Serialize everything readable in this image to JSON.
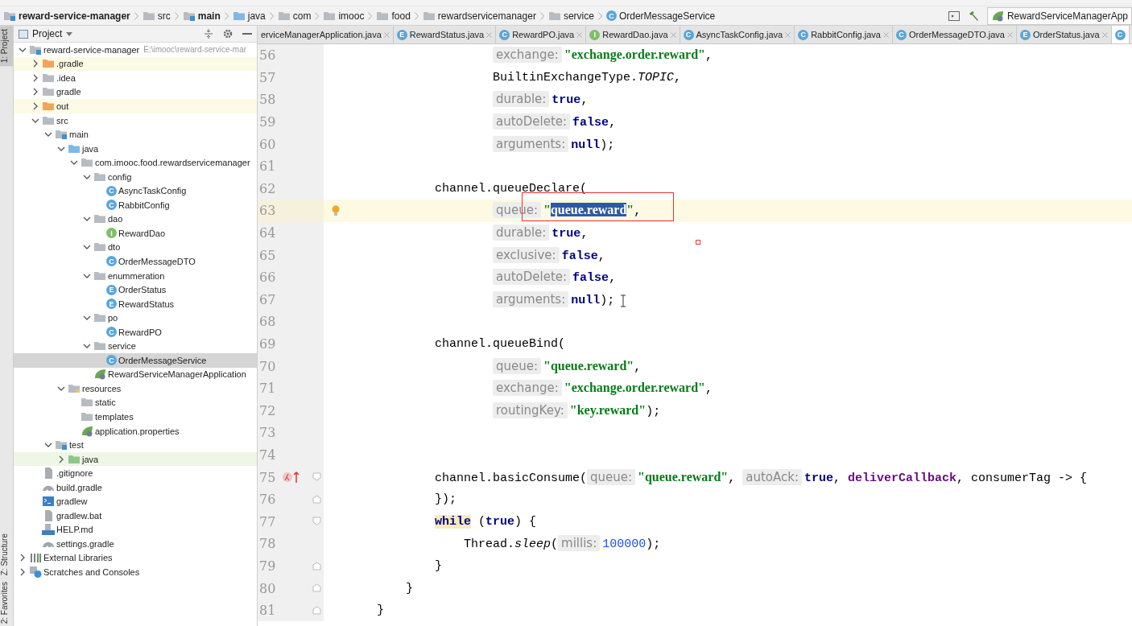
{
  "breadcrumbs": [
    {
      "label": "reward-service-manager",
      "kind": "module",
      "bold": true
    },
    {
      "label": "src",
      "kind": "folder",
      "bold": false
    },
    {
      "label": "main",
      "kind": "module",
      "bold": true
    },
    {
      "label": "java",
      "kind": "source",
      "bold": false
    },
    {
      "label": "com",
      "kind": "package",
      "bold": false
    },
    {
      "label": "imooc",
      "kind": "package",
      "bold": false
    },
    {
      "label": "food",
      "kind": "package",
      "bold": false
    },
    {
      "label": "rewardservicemanager",
      "kind": "package",
      "bold": false
    },
    {
      "label": "service",
      "kind": "package",
      "bold": false
    },
    {
      "label": "OrderMessageService",
      "kind": "class",
      "badge": "C",
      "bold": false
    }
  ],
  "run_config": {
    "label": "RewardServiceManagerApp"
  },
  "tool_strip": [
    {
      "label": "1: Project",
      "selected": true
    },
    {
      "label": "Z: Structure",
      "selected": false
    },
    {
      "label": "2: Favorites",
      "selected": false
    }
  ],
  "project_panel": {
    "title": "Project",
    "tree": [
      {
        "label": "reward-service-manager",
        "path": "E:\\imooc\\reward-service-mar",
        "kind": "module",
        "expanded": true,
        "selected": false,
        "children": [
          {
            "label": ".gradle",
            "kind": "excluded",
            "expanded": false,
            "selected": false
          },
          {
            "label": ".idea",
            "kind": "folder",
            "expanded": false,
            "selected": false
          },
          {
            "label": "gradle",
            "kind": "folder",
            "expanded": false,
            "selected": false
          },
          {
            "label": "out",
            "kind": "excluded",
            "expanded": false,
            "selected": false
          },
          {
            "label": "src",
            "kind": "folder",
            "expanded": true,
            "selected": false,
            "children": [
              {
                "label": "main",
                "kind": "module",
                "expanded": true,
                "selected": false,
                "children": [
                  {
                    "label": "java",
                    "kind": "source",
                    "expanded": true,
                    "selected": false,
                    "children": [
                      {
                        "label": "com.imooc.food.rewardservicemanager",
                        "kind": "package",
                        "expanded": true,
                        "selected": false,
                        "children": [
                          {
                            "label": "config",
                            "kind": "package",
                            "expanded": true,
                            "selected": false,
                            "children": [
                              {
                                "label": "AsyncTaskConfig",
                                "kind": "class",
                                "badge": "C",
                                "selected": false
                              },
                              {
                                "label": "RabbitConfig",
                                "kind": "class",
                                "badge": "C",
                                "selected": false
                              }
                            ]
                          },
                          {
                            "label": "dao",
                            "kind": "package",
                            "expanded": true,
                            "selected": false,
                            "children": [
                              {
                                "label": "RewardDao",
                                "kind": "interface",
                                "badge": "I",
                                "selected": false
                              }
                            ]
                          },
                          {
                            "label": "dto",
                            "kind": "package",
                            "expanded": true,
                            "selected": false,
                            "children": [
                              {
                                "label": "OrderMessageDTO",
                                "kind": "class",
                                "badge": "C",
                                "selected": false
                              }
                            ]
                          },
                          {
                            "label": "enummeration",
                            "kind": "package",
                            "expanded": true,
                            "selected": false,
                            "children": [
                              {
                                "label": "OrderStatus",
                                "kind": "class",
                                "badge": "E",
                                "selected": false
                              },
                              {
                                "label": "RewardStatus",
                                "kind": "class",
                                "badge": "E",
                                "selected": false
                              }
                            ]
                          },
                          {
                            "label": "po",
                            "kind": "package",
                            "expanded": true,
                            "selected": false,
                            "children": [
                              {
                                "label": "RewardPO",
                                "kind": "class",
                                "badge": "C",
                                "selected": false
                              }
                            ]
                          },
                          {
                            "label": "service",
                            "kind": "package",
                            "expanded": true,
                            "selected": false,
                            "children": [
                              {
                                "label": "OrderMessageService",
                                "kind": "class",
                                "badge": "C",
                                "selected": true
                              }
                            ]
                          },
                          {
                            "label": "RewardServiceManagerApplication",
                            "kind": "spring",
                            "selected": false
                          }
                        ]
                      }
                    ]
                  },
                  {
                    "label": "resources",
                    "kind": "resources",
                    "expanded": true,
                    "selected": false,
                    "children": [
                      {
                        "label": "static",
                        "kind": "package",
                        "selected": false
                      },
                      {
                        "label": "templates",
                        "kind": "package",
                        "selected": false
                      },
                      {
                        "label": "application.properties",
                        "kind": "spring",
                        "selected": false
                      }
                    ]
                  }
                ]
              },
              {
                "label": "test",
                "kind": "module",
                "expanded": true,
                "selected": false,
                "children": [
                  {
                    "label": "java",
                    "kind": "test",
                    "expanded": false,
                    "selected": false
                  }
                ]
              }
            ]
          },
          {
            "label": ".gitignore",
            "kind": "file",
            "selected": false
          },
          {
            "label": "build.gradle",
            "kind": "gradle",
            "selected": false
          },
          {
            "label": "gradlew",
            "kind": "terminal",
            "selected": false
          },
          {
            "label": "gradlew.bat",
            "kind": "file",
            "selected": false
          },
          {
            "label": "HELP.md",
            "kind": "markdown",
            "selected": false
          },
          {
            "label": "settings.gradle",
            "kind": "gradle",
            "selected": false
          }
        ]
      },
      {
        "label": "External Libraries",
        "kind": "libraries",
        "expanded": false,
        "selected": false
      },
      {
        "label": "Scratches and Consoles",
        "kind": "scratches",
        "expanded": false,
        "selected": false
      }
    ]
  },
  "tabs": [
    {
      "label": "erviceManagerApplication.java",
      "kind": "plain",
      "selected": false
    },
    {
      "label": "RewardStatus.java",
      "badge": "E",
      "kind": "class",
      "selected": false
    },
    {
      "label": "RewardPO.java",
      "badge": "C",
      "kind": "class",
      "selected": false
    },
    {
      "label": "RewardDao.java",
      "badge": "I",
      "kind": "interface",
      "selected": false
    },
    {
      "label": "AsyncTaskConfig.java",
      "badge": "C",
      "kind": "class",
      "selected": false
    },
    {
      "label": "RabbitConfig.java",
      "badge": "C",
      "kind": "class",
      "selected": false
    },
    {
      "label": "OrderMessageDTO.java",
      "badge": "C",
      "kind": "class",
      "selected": false
    },
    {
      "label": "OrderStatus.java",
      "badge": "E",
      "kind": "class",
      "selected": false
    },
    {
      "badge": "C",
      "kind": "class",
      "selected": true
    }
  ],
  "editor": {
    "lines": [
      {
        "number": "56",
        "kind": "arg",
        "current": false,
        "tokens": [
          {
            "kind": "hint",
            "text": "exchange:"
          },
          {
            "kind": "string",
            "text": "\"exchange.order.reward\""
          },
          {
            "kind": "plain",
            "text": ","
          }
        ]
      },
      {
        "number": "57",
        "kind": "arg",
        "current": false,
        "tokens": [
          {
            "kind": "plain",
            "text": "BuiltinExchangeType."
          },
          {
            "kind": "static",
            "text": "TOPIC"
          },
          {
            "kind": "plain",
            "text": ","
          }
        ]
      },
      {
        "number": "58",
        "kind": "arg",
        "current": false,
        "tokens": [
          {
            "kind": "hint",
            "text": "durable:"
          },
          {
            "kind": "keyword",
            "text": "true"
          },
          {
            "kind": "plain",
            "text": ","
          }
        ]
      },
      {
        "number": "59",
        "kind": "arg",
        "current": false,
        "tokens": [
          {
            "kind": "hint",
            "text": "autoDelete:"
          },
          {
            "kind": "keyword",
            "text": "false"
          },
          {
            "kind": "plain",
            "text": ","
          }
        ]
      },
      {
        "number": "60",
        "kind": "arg",
        "current": false,
        "tokens": [
          {
            "kind": "hint",
            "text": "arguments:"
          },
          {
            "kind": "keyword",
            "text": "null"
          },
          {
            "kind": "plain",
            "text": ");"
          }
        ]
      },
      {
        "number": "61",
        "current": false
      },
      {
        "number": "62",
        "kind": "statement",
        "current": false,
        "tokens": [
          {
            "kind": "plain",
            "text": "channel.queueDeclare("
          }
        ]
      },
      {
        "number": "63",
        "kind": "arg",
        "current": true,
        "gutter_icon": {
          "kind": "bulb"
        },
        "tokens": [
          {
            "kind": "hint",
            "text": "queue:"
          },
          {
            "kind": "string",
            "text": "\""
          },
          {
            "kind": "selection",
            "text": "queue.reward"
          },
          {
            "kind": "string",
            "text": "\""
          },
          {
            "kind": "plain",
            "text": ","
          }
        ]
      },
      {
        "number": "64",
        "kind": "arg",
        "current": false,
        "tokens": [
          {
            "kind": "hint",
            "text": "durable:"
          },
          {
            "kind": "keyword",
            "text": "true"
          },
          {
            "kind": "plain",
            "text": ","
          }
        ]
      },
      {
        "number": "65",
        "kind": "arg",
        "current": false,
        "tokens": [
          {
            "kind": "hint",
            "text": "exclusive:"
          },
          {
            "kind": "keyword",
            "text": "false"
          },
          {
            "kind": "plain",
            "text": ","
          }
        ]
      },
      {
        "number": "66",
        "kind": "arg",
        "current": false,
        "tokens": [
          {
            "kind": "hint",
            "text": "autoDelete:"
          },
          {
            "kind": "keyword",
            "text": "false"
          },
          {
            "kind": "plain",
            "text": ","
          }
        ]
      },
      {
        "number": "67",
        "kind": "arg",
        "current": false,
        "tokens": [
          {
            "kind": "hint",
            "text": "arguments:"
          },
          {
            "kind": "keyword",
            "text": "null"
          },
          {
            "kind": "plain",
            "text": ");"
          }
        ]
      },
      {
        "number": "68",
        "current": false
      },
      {
        "number": "69",
        "kind": "statement",
        "current": false,
        "tokens": [
          {
            "kind": "plain",
            "text": "channel.queueBind("
          }
        ]
      },
      {
        "number": "70",
        "kind": "arg",
        "current": false,
        "tokens": [
          {
            "kind": "hint",
            "text": "queue:"
          },
          {
            "kind": "string",
            "text": "\"queue.reward\""
          },
          {
            "kind": "plain",
            "text": ","
          }
        ]
      },
      {
        "number": "71",
        "kind": "arg",
        "current": false,
        "tokens": [
          {
            "kind": "hint",
            "text": "exchange:"
          },
          {
            "kind": "string",
            "text": "\"exchange.order.reward\""
          },
          {
            "kind": "plain",
            "text": ","
          }
        ]
      },
      {
        "number": "72",
        "kind": "arg",
        "current": false,
        "tokens": [
          {
            "kind": "hint",
            "text": "routingKey:"
          },
          {
            "kind": "string",
            "text": "\"key.reward\""
          },
          {
            "kind": "plain",
            "text": ");"
          }
        ]
      },
      {
        "number": "73",
        "current": false
      },
      {
        "number": "74",
        "current": false
      },
      {
        "number": "75",
        "kind": "statement",
        "current": false,
        "gutter_icon": {
          "kind": "lambda"
        },
        "fold_marker": {
          "kind": "start"
        },
        "tokens": [
          {
            "kind": "plain",
            "text": "channel.basicConsume("
          },
          {
            "kind": "hint",
            "text": "queue:"
          },
          {
            "kind": "string",
            "text": "\"queue.reward\""
          },
          {
            "kind": "plain",
            "text": ", "
          },
          {
            "kind": "hint",
            "text": "autoAck:"
          },
          {
            "kind": "keyword",
            "text": "true"
          },
          {
            "kind": "plain",
            "text": ", "
          },
          {
            "kind": "field",
            "text": "deliverCallback"
          },
          {
            "kind": "plain",
            "text": ", consumerTag -> {"
          }
        ]
      },
      {
        "number": "76",
        "kind": "statement",
        "current": false,
        "fold_marker": {
          "kind": "end"
        },
        "tokens": [
          {
            "kind": "plain",
            "text": "});"
          }
        ]
      },
      {
        "number": "77",
        "kind": "statement",
        "current": false,
        "fold_marker": {
          "kind": "start"
        },
        "tokens": [
          {
            "kind": "marked",
            "text": "while"
          },
          {
            "kind": "plain",
            "text": " ("
          },
          {
            "kind": "keyword",
            "text": "true"
          },
          {
            "kind": "plain",
            "text": ") {"
          }
        ]
      },
      {
        "number": "78",
        "kind": "body",
        "current": false,
        "tokens": [
          {
            "kind": "plain",
            "text": "Thread."
          },
          {
            "kind": "static",
            "text": "sleep"
          },
          {
            "kind": "plain",
            "text": "("
          },
          {
            "kind": "hint",
            "text": "millis:"
          },
          {
            "kind": "number",
            "text": "100000"
          },
          {
            "kind": "plain",
            "text": ");"
          }
        ]
      },
      {
        "number": "79",
        "kind": "statement",
        "current": false,
        "fold_marker": {
          "kind": "end"
        },
        "tokens": [
          {
            "kind": "plain",
            "text": "}"
          }
        ]
      },
      {
        "number": "80",
        "kind": "method",
        "current": false,
        "fold_marker": {
          "kind": "end"
        },
        "tokens": [
          {
            "kind": "plain",
            "text": "}"
          }
        ]
      },
      {
        "number": "81",
        "kind": "class",
        "current": false,
        "fold_marker": {
          "kind": "end"
        },
        "tokens": [
          {
            "kind": "plain",
            "text": "}"
          }
        ]
      }
    ]
  }
}
